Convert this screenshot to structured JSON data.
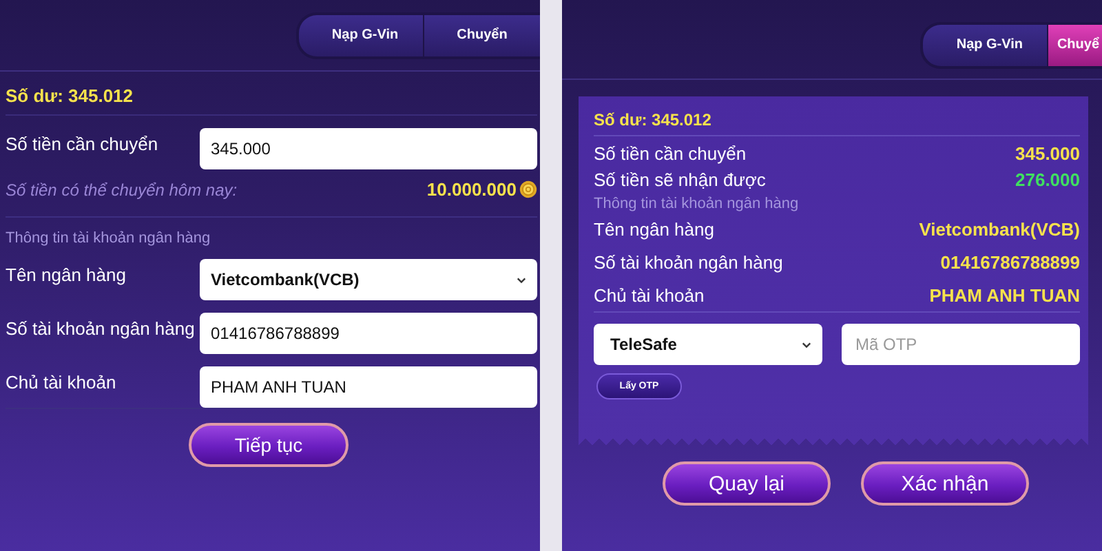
{
  "form_panel": {
    "tabs": [
      {
        "label": "Nạp G-Vin",
        "selected": false
      },
      {
        "label": "Chuyển",
        "selected": false
      }
    ],
    "balance": "Số dư: 345.012",
    "amount": {
      "label": "Số tiền cần chuyển",
      "value": "345.000"
    },
    "limit": {
      "label": "Số tiền có thể chuyển hôm nay:",
      "value": "10.000.000"
    },
    "section": "Thông tin tài khoản ngân hàng",
    "fields": [
      {
        "kind": "select",
        "label": "Tên ngân hàng",
        "value": "Vietcombank(VCB)"
      },
      {
        "kind": "input",
        "label": "Số tài khoản ngân hàng",
        "value": "01416786788899"
      },
      {
        "kind": "input",
        "label": "Chủ tài khoản",
        "value": "PHAM ANH TUAN"
      }
    ],
    "button": "Tiếp tục"
  },
  "confirm_panel": {
    "tabs": [
      {
        "label": "Nạp G-Vin",
        "selected": false
      },
      {
        "label": "Chuyể",
        "selected": true
      }
    ],
    "balance": "Số dư: 345.012",
    "amounts": [
      {
        "label": "Số tiền cần chuyển",
        "value": "345.000",
        "color": "#f6e24c"
      },
      {
        "label": "Số tiền sẽ nhận được",
        "value": "276.000",
        "color": "#3fe060"
      }
    ],
    "section": "Thông tin tài khoản ngân hàng",
    "details": [
      {
        "label": "Tên ngân hàng",
        "value": "Vietcombank(VCB)"
      },
      {
        "label": "Số tài khoản ngân hàng",
        "value": "01416786788899"
      },
      {
        "label": "Chủ tài khoản",
        "value": "PHAM ANH TUAN"
      }
    ],
    "otp_method": "TeleSafe",
    "otp_placeholder": "Mã OTP",
    "otp_button": "Lấy OTP",
    "buttons": [
      "Quay lại",
      "Xác nhận"
    ]
  }
}
